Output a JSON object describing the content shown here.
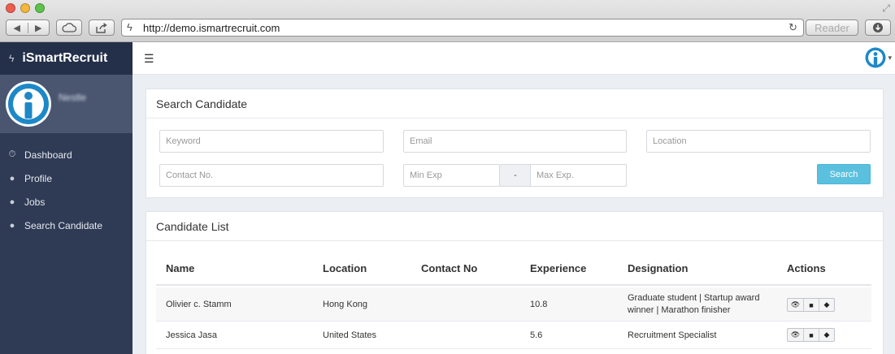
{
  "browser": {
    "url": "http://demo.ismartrecruit.com",
    "reader_label": "Reader"
  },
  "sidebar": {
    "brand": "iSmartRecruit",
    "user_name": "Nestle",
    "items": [
      {
        "label": "Dashboard",
        "icon": "stopwatch-icon"
      },
      {
        "label": "Profile",
        "icon": "user-icon"
      },
      {
        "label": "Jobs",
        "icon": "user-icon"
      },
      {
        "label": "Search Candidate",
        "icon": "user-icon"
      }
    ]
  },
  "search": {
    "title": "Search Candidate",
    "keyword_placeholder": "Keyword",
    "email_placeholder": "Email",
    "location_placeholder": "Location",
    "contact_placeholder": "Contact No.",
    "min_exp_placeholder": "Min Exp",
    "range_separator": "-",
    "max_exp_placeholder": "Max Exp.",
    "button_label": "Search"
  },
  "candidates": {
    "title": "Candidate List",
    "columns": [
      "Name",
      "Location",
      "Contact No",
      "Experience",
      "Designation",
      "Actions"
    ],
    "rows": [
      {
        "name": "Olivier c. Stamm",
        "location": "Hong Kong",
        "contact": "",
        "experience": "10.8",
        "designation_line1": "Graduate student | Startup award",
        "designation_line2": "winner | Marathon finisher"
      },
      {
        "name": "Jessica Jasa",
        "location": "United States",
        "contact": "",
        "experience": "5.6",
        "designation_line1": "Recruitment Specialist",
        "designation_line2": ""
      }
    ]
  },
  "colors": {
    "sidebar": "#2f3b55",
    "brand_bar": "#24304a",
    "search_button": "#5bc0de",
    "logo_blue": "#1e88c7"
  }
}
